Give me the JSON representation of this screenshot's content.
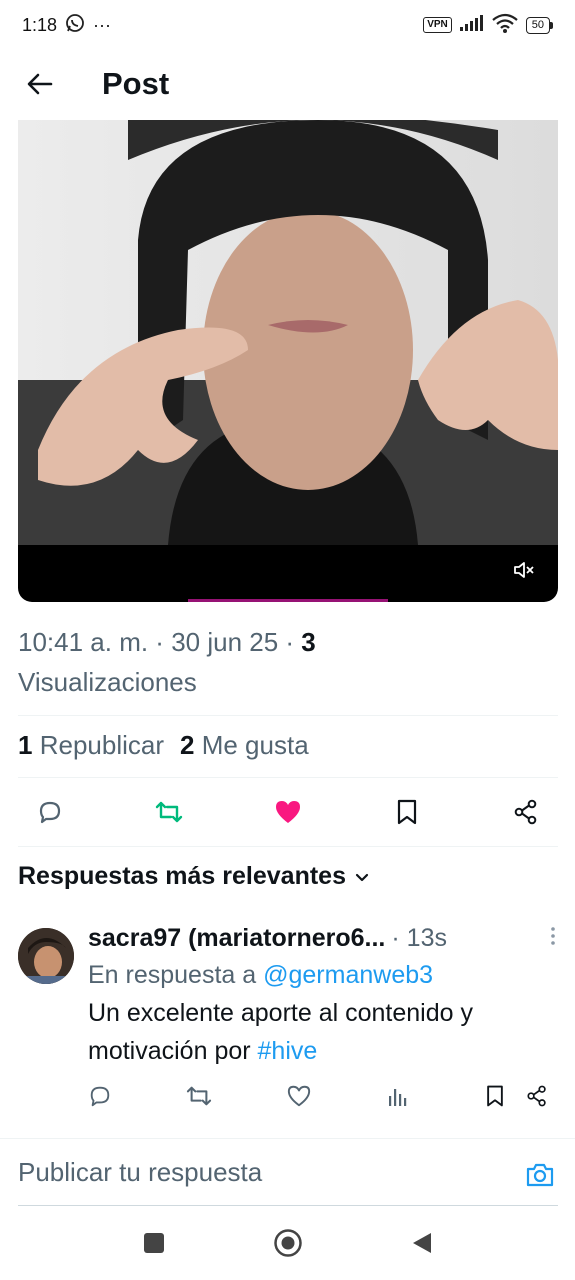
{
  "status_bar": {
    "time": "1:18",
    "whatsapp_icon": "whatsapp-icon",
    "more_notifications": "···",
    "vpn": "VPN",
    "battery": "50"
  },
  "header": {
    "title": "Post"
  },
  "post": {
    "time": "10:41 a. m.",
    "date": "30 jun 25",
    "views_count": "3",
    "views_label": "Visualizaciones",
    "reposts_count": "1",
    "reposts_label": "Republicar",
    "likes_count": "2",
    "likes_label": "Me gusta",
    "liked": true,
    "accent_like": "#f91880",
    "accent_repost": "#00ba7c"
  },
  "replies": {
    "sort_label": "Respuestas más relevantes",
    "items": [
      {
        "name": "sacra97 (mariatornero6...",
        "time": "13s",
        "reply_to_prefix": "En respuesta a",
        "reply_to_handle": "@germanweb3",
        "text_main": "Un excelente aporte al contenido y motivación por",
        "text_hashtag": "#hive"
      }
    ]
  },
  "composer": {
    "placeholder": "Publicar tu respuesta"
  },
  "colors": {
    "link": "#1d9bf0",
    "secondary_text": "#536471"
  }
}
